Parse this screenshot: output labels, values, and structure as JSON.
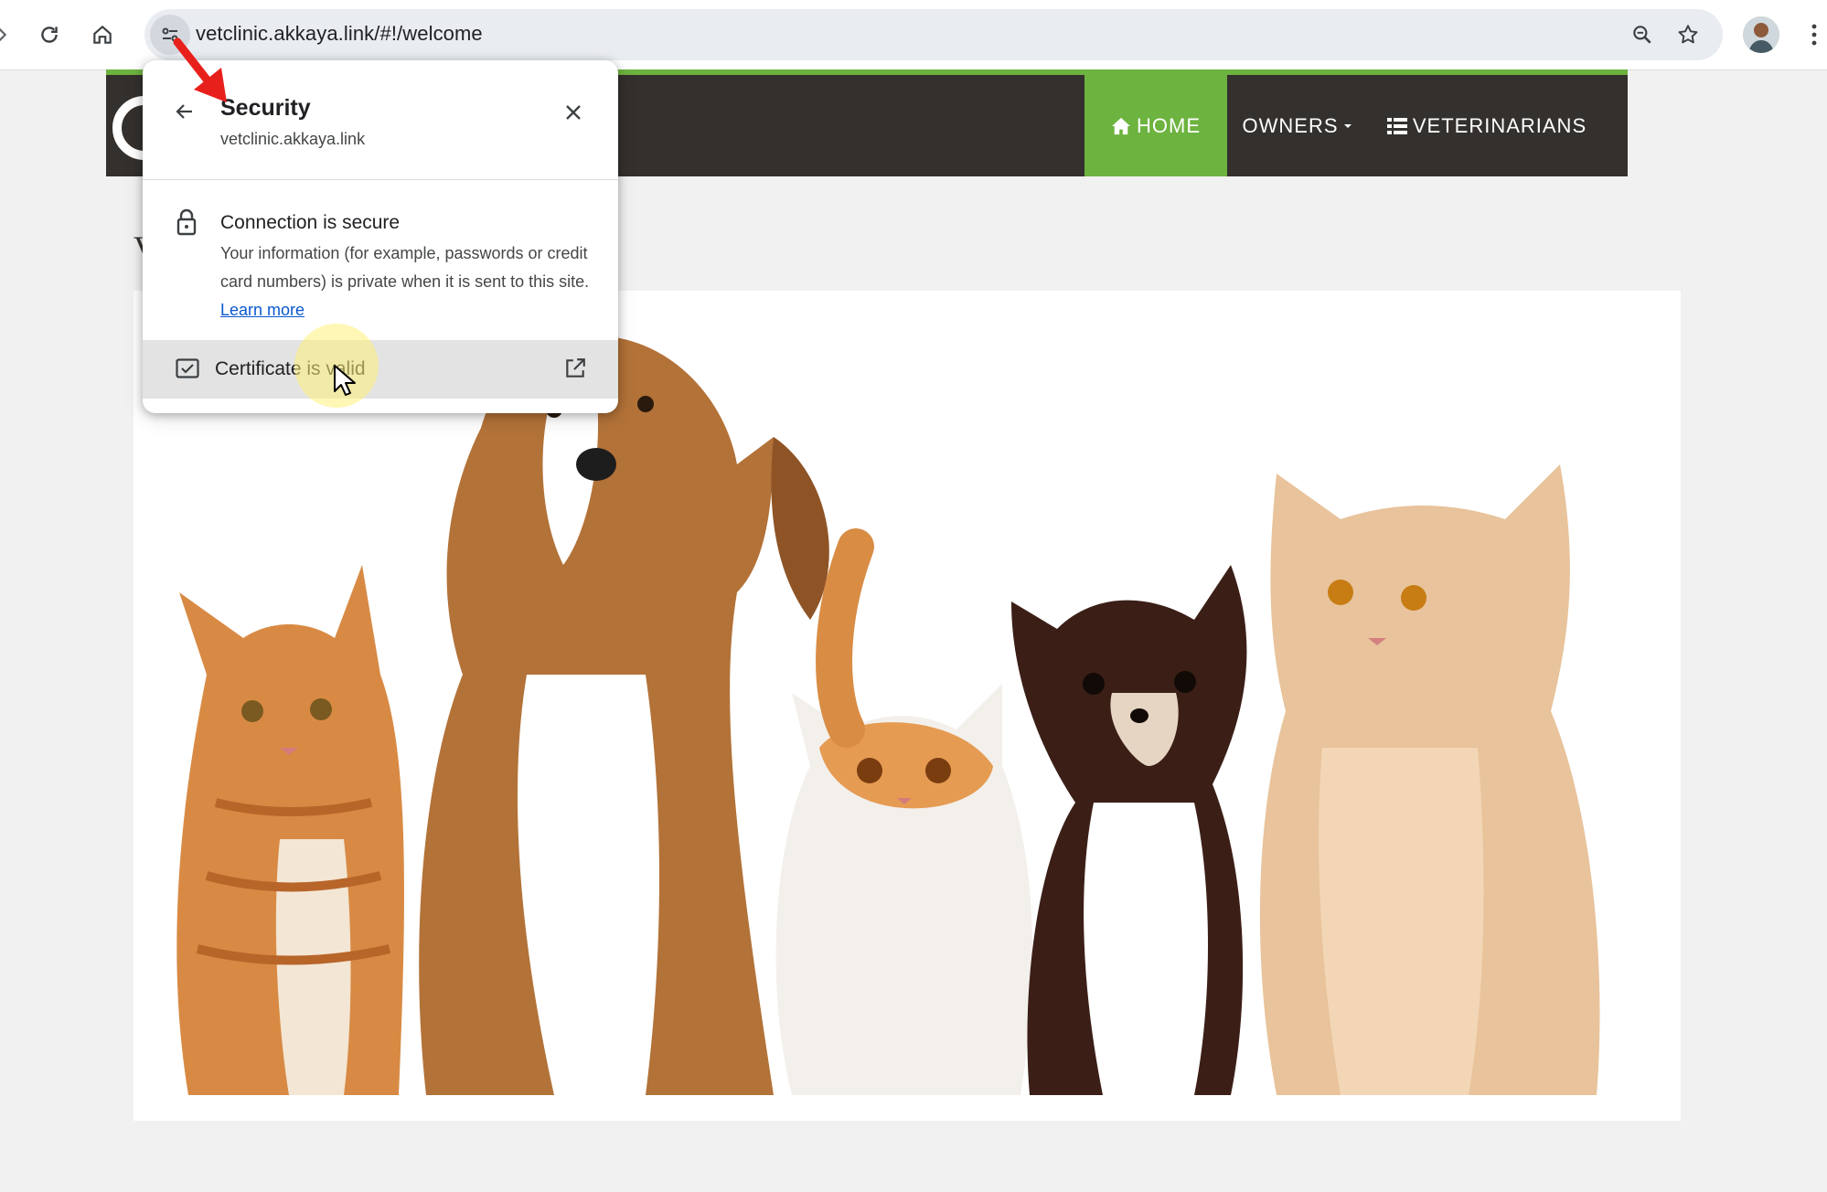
{
  "browser": {
    "url": "vetclinic.akkaya.link/#!/welcome",
    "icons": {
      "reload": "reload-icon",
      "home": "home-icon",
      "site_info": "tune-icon",
      "zoom": "zoom-icon",
      "bookmark": "star-icon",
      "menu": "more-vert-icon",
      "profile": "avatar"
    }
  },
  "nav": {
    "home": "HOME",
    "owners": "OWNERS",
    "vets": "VETERINARIANS"
  },
  "page": {
    "heading_fragment": "V"
  },
  "security_popup": {
    "title": "Security",
    "domain": "vetclinic.akkaya.link",
    "connection_title": "Connection is secure",
    "connection_body": "Your information (for example, passwords or credit card numbers) is private when it is sent to this site.",
    "learn_more": "Learn more",
    "certificate": "Certificate is valid"
  },
  "colors": {
    "accent_green": "#6db33f",
    "navbar_dark": "#34302d",
    "link_blue": "#0b57d0",
    "annotation_red": "#e8201c"
  }
}
